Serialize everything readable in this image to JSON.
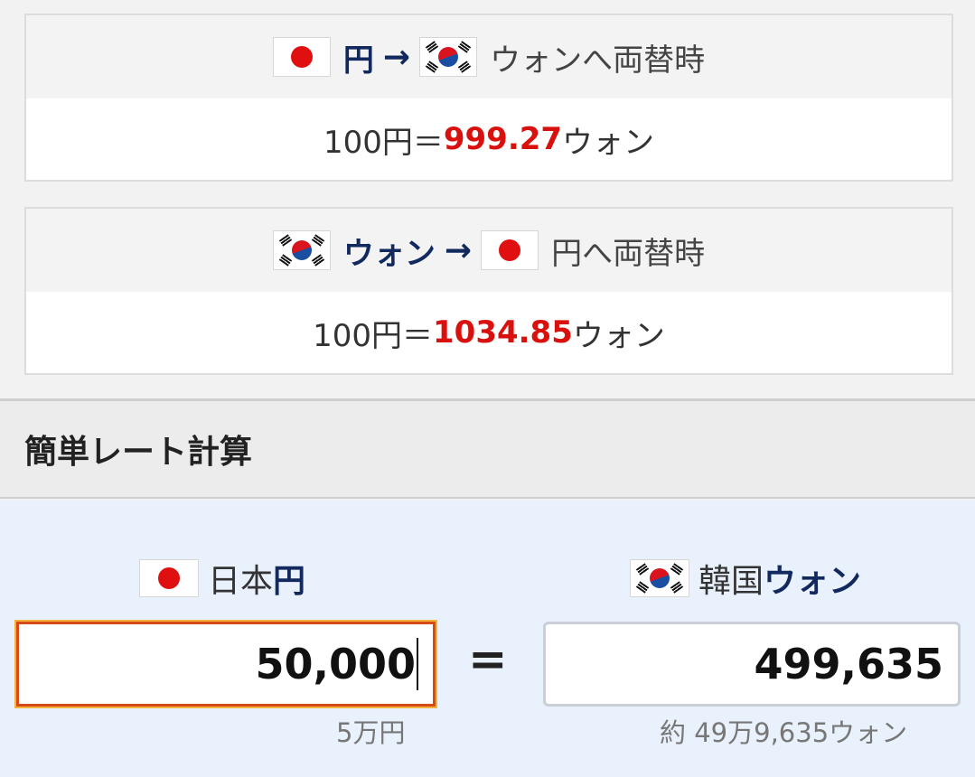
{
  "rate_cards": [
    {
      "from_label": "円",
      "arrow": "→",
      "to_suffix": "ウォンへ両替時",
      "prefix": "100円＝",
      "value": "999.27",
      "unit": "ウォン"
    },
    {
      "from_label": "ウォン",
      "arrow": "→",
      "to_suffix": "円へ両替時",
      "prefix": "100円＝",
      "value": "1034.85",
      "unit": "ウォン"
    }
  ],
  "calculator": {
    "title": "簡単レート計算",
    "left_label_plain": "日本",
    "left_label_bold": "円",
    "right_label_plain": "韓国",
    "right_label_bold": "ウォン",
    "input_value": "50,000",
    "equals": "=",
    "output_value": "499,635",
    "input_sub": "5万円",
    "output_sub": "約 49万9,635ウォン"
  },
  "icons": {
    "japan_flag": "japan-flag-icon",
    "korea_flag": "korea-flag-icon",
    "arrow": "arrow-right-icon"
  },
  "colors": {
    "accent_red": "#d9110e",
    "currency_navy": "#12295e",
    "calc_bg": "#e9f1fc",
    "input_border": "#d64a1a"
  }
}
